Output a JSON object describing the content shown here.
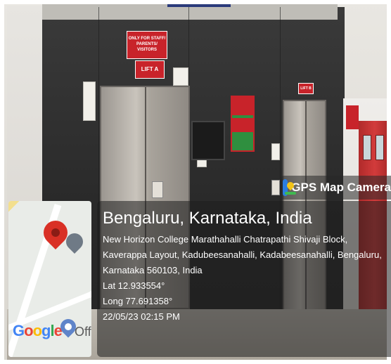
{
  "scene": {
    "signs": {
      "staff_sign": "ONLY FOR STAFF/ PARENTS/ VISITORS",
      "lift_a": "LIFT A",
      "lift_b": "LIFT B"
    }
  },
  "overlay": {
    "app_name": "GPS Map Camera",
    "location_title": "Bengaluru, Karnataka, India",
    "address": "New Horizon College Marathahalli  Chatrapathi Shivaji Block, Kaverappa Layout, Kadubeesanahalli, Kadabeesanahalli, Bengaluru, Karnataka 560103, India",
    "latitude": "Lat 12.933554°",
    "longitude": "Long 77.691358°",
    "datetime": "22/05/23 02:15 PM",
    "map_logo": "Google",
    "map_logo_suffix": "Off"
  },
  "colors": {
    "sign_red": "#c8232a",
    "overlay_bg": "rgba(30,30,30,0.55)",
    "exit_green": "#2f8f3f"
  }
}
